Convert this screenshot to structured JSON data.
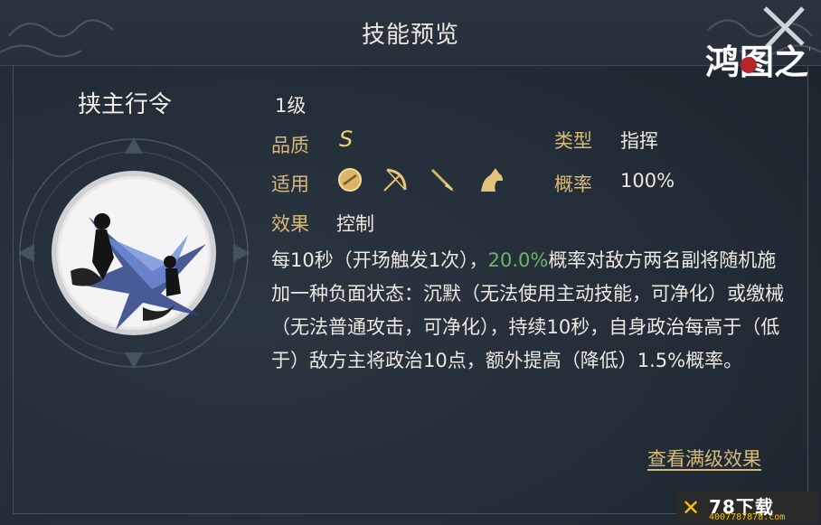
{
  "header": {
    "title": "技能预览"
  },
  "logo": {
    "text": "鸿图之下"
  },
  "skill": {
    "name": "挟主行令",
    "level": "1级",
    "quality_label": "品质",
    "quality_value": "S",
    "type_label": "类型",
    "type_value": "指挥",
    "applicable_label": "适用",
    "applicable_icons": [
      "shield-icon",
      "bow-icon",
      "spear-icon",
      "horse-icon"
    ],
    "chance_label": "概率",
    "chance_value": "100%",
    "effect_label": "效果",
    "effect_value": "控制",
    "description_pre": "每10秒（开场触发1次），",
    "description_highlight": "20.0%",
    "description_post": "概率对敌方两名副将随机施加一种负面状态：沉默（无法使用主动技能，可净化）或缴械（无法普通攻击，可净化），持续10秒，自身政治每高于（低于）敌方主将政治10点，额外提高（降低）1.5%概率。"
  },
  "actions": {
    "view_max_level": "查看满级效果"
  },
  "watermark": {
    "main": "78下载",
    "sub": "4007787878.com"
  },
  "colors": {
    "label": "#d8b978",
    "highlight": "#6db36a",
    "grade": "#f2cf63",
    "background": "#232d37"
  }
}
